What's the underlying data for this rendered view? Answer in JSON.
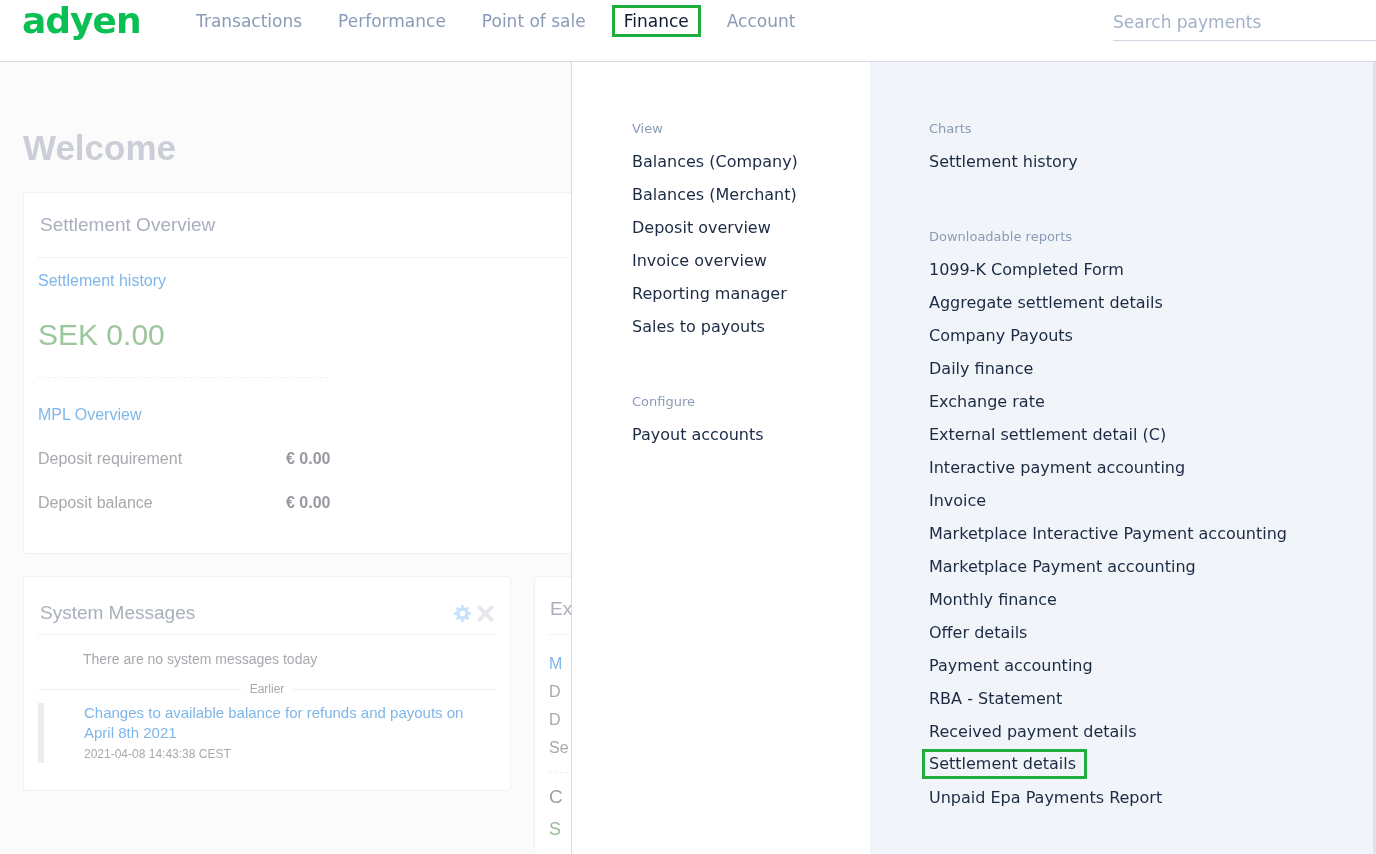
{
  "header": {
    "logo": "adyen",
    "nav": [
      {
        "label": "Transactions",
        "selected": false,
        "highlighted": false
      },
      {
        "label": "Performance",
        "selected": false,
        "highlighted": false
      },
      {
        "label": "Point of sale",
        "selected": false,
        "highlighted": false
      },
      {
        "label": "Finance",
        "selected": true,
        "highlighted": true
      },
      {
        "label": "Account",
        "selected": false,
        "highlighted": false
      }
    ],
    "search": {
      "placeholder": "Search payments"
    }
  },
  "page": {
    "title": "Welcome",
    "settlement_card": {
      "title": "Settlement Overview",
      "link": "Settlement history",
      "amount": "SEK 0.00",
      "section_link": "MPL Overview",
      "rows": [
        {
          "label": "Deposit requirement",
          "value": "€ 0.00"
        },
        {
          "label": "Deposit balance",
          "value": "€ 0.00"
        }
      ]
    },
    "messages_card": {
      "title": "System Messages",
      "empty_text": "There are no system messages today",
      "divider_label": "Earlier",
      "messages": [
        {
          "title": "Changes to available balance for refunds and payouts on April 8th 2021",
          "timestamp": "2021-04-08 14:43:38 CEST"
        }
      ]
    },
    "partial_card": {
      "title": "Ex",
      "lines": [
        {
          "text": "M",
          "kind": "link"
        },
        {
          "text": "D",
          "kind": "text"
        },
        {
          "text": "D",
          "kind": "text"
        },
        {
          "text": "Se",
          "kind": "text"
        },
        {
          "text": "C",
          "kind": "heading"
        },
        {
          "text": "S",
          "kind": "amount"
        }
      ]
    }
  },
  "menu": {
    "columns": [
      {
        "sections": [
          {
            "heading": "View",
            "items": [
              {
                "label": "Balances (Company)",
                "highlighted": false
              },
              {
                "label": "Balances (Merchant)",
                "highlighted": false
              },
              {
                "label": "Deposit overview",
                "highlighted": false
              },
              {
                "label": "Invoice overview",
                "highlighted": false
              },
              {
                "label": "Reporting manager",
                "highlighted": false
              },
              {
                "label": "Sales to payouts",
                "highlighted": false
              }
            ]
          },
          {
            "heading": "Configure",
            "items": [
              {
                "label": "Payout accounts",
                "highlighted": false
              }
            ]
          }
        ]
      },
      {
        "sections": [
          {
            "heading": "Charts",
            "items": [
              {
                "label": "Settlement history",
                "highlighted": false
              }
            ]
          },
          {
            "heading": "Downloadable reports",
            "items": [
              {
                "label": "1099-K Completed Form",
                "highlighted": false
              },
              {
                "label": "Aggregate settlement details",
                "highlighted": false
              },
              {
                "label": "Company Payouts",
                "highlighted": false
              },
              {
                "label": "Daily finance",
                "highlighted": false
              },
              {
                "label": "Exchange rate",
                "highlighted": false
              },
              {
                "label": "External settlement detail (C)",
                "highlighted": false
              },
              {
                "label": "Interactive payment accounting",
                "highlighted": false
              },
              {
                "label": "Invoice",
                "highlighted": false
              },
              {
                "label": "Marketplace Interactive Payment accounting",
                "highlighted": false
              },
              {
                "label": "Marketplace Payment accounting",
                "highlighted": false
              },
              {
                "label": "Monthly finance",
                "highlighted": false
              },
              {
                "label": "Offer details",
                "highlighted": false
              },
              {
                "label": "Payment accounting",
                "highlighted": false
              },
              {
                "label": "RBA - Statement",
                "highlighted": false
              },
              {
                "label": "Received payment details",
                "highlighted": false
              },
              {
                "label": "Settlement details",
                "highlighted": true
              },
              {
                "label": "Unpaid Epa Payments Report",
                "highlighted": false
              }
            ]
          }
        ]
      }
    ]
  }
}
